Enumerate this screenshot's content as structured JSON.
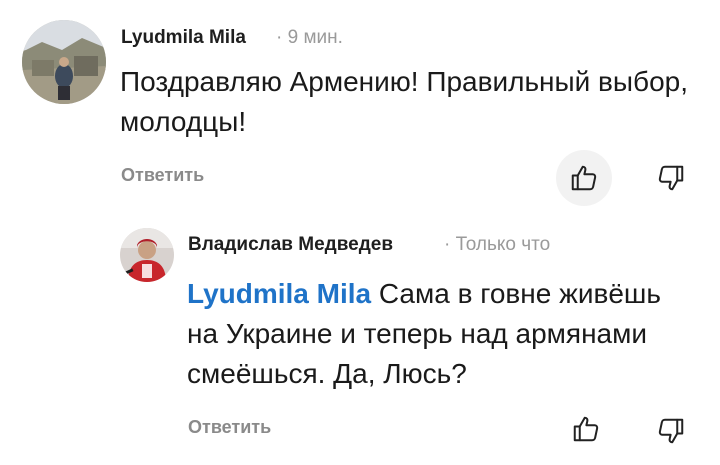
{
  "comments": [
    {
      "author": "Lyudmila Mila",
      "separator": "·",
      "time": "9 мин.",
      "text": "Поздравляю Армению! Правильный выбор, молодцы!",
      "reply_label": "Ответить",
      "avatar_icon": "avatar-landscape-photo"
    },
    {
      "author": "Владислав Медведев",
      "separator": "·",
      "time": "Только что",
      "mention": "Lyudmila Mila",
      "text": "Сама в говне живёшь на Украине и теперь над армянами смеёшься. Да, Люсь?",
      "reply_label": "Ответить",
      "avatar_icon": "avatar-hockey-player-photo"
    }
  ],
  "icons": {
    "like": "thumbs-up-icon",
    "dislike": "thumbs-down-icon"
  },
  "colors": {
    "mention": "#1f73c8",
    "meta": "#9a9a9a",
    "reply": "#8a8a8a",
    "like_bg": "#f2f2f2"
  }
}
